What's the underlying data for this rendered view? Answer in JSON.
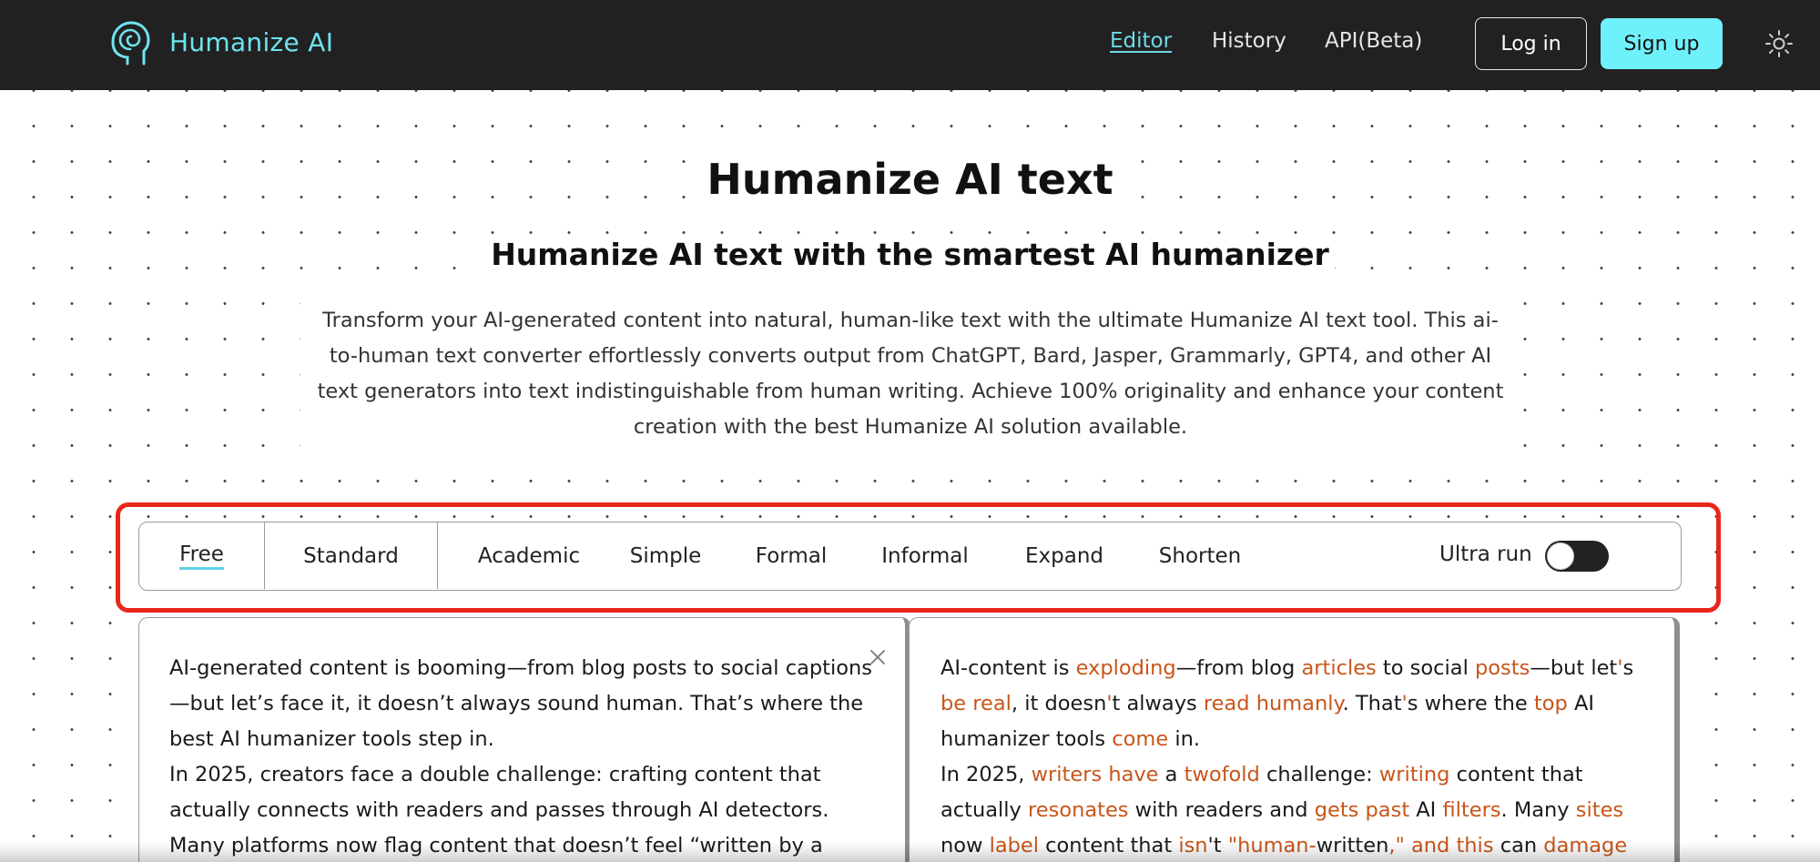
{
  "header": {
    "brand": "Humanize AI",
    "nav": [
      {
        "label": "Editor",
        "active": true
      },
      {
        "label": "History",
        "active": false
      },
      {
        "label": "API(Beta)",
        "active": false
      }
    ],
    "login_label": "Log in",
    "signup_label": "Sign up",
    "icons": {
      "logo": "head-spiral-icon",
      "theme": "sun-icon"
    }
  },
  "hero": {
    "title": "Humanize AI text",
    "subtitle": "Humanize AI text with the smartest AI humanizer",
    "description": "Transform your AI-generated content into natural, human-like text with the ultimate Humanize AI text tool. This ai-to-human text converter effortlessly converts output from ChatGPT, Bard, Jasper, Grammarly, GPT4, and other AI text generators into text indistinguishable from human writing. Achieve 100% originality and enhance your content creation with the best Humanize AI solution available."
  },
  "modes": {
    "items": [
      "Free",
      "Standard",
      "Academic",
      "Simple",
      "Formal",
      "Informal",
      "Expand",
      "Shorten"
    ],
    "selected": "Free",
    "ultra_run_label": "Ultra run",
    "ultra_run_enabled": false
  },
  "editor": {
    "input_paragraphs": [
      "AI-generated content is booming—from blog posts to social captions—but let’s face it, it doesn’t always sound human. That’s where the best AI humanizer tools step in.",
      "In 2025, creators face a double challenge: crafting content that actually connects with readers and passes through AI detectors. Many platforms now flag content that doesn’t feel “written by a human,” which can hurt"
    ],
    "output_paragraphs": [
      [
        {
          "t": "AI-content is "
        },
        {
          "t": "exploding",
          "c": 1
        },
        {
          "t": "—from blog "
        },
        {
          "t": "articles",
          "c": 1
        },
        {
          "t": " to social "
        },
        {
          "t": "posts",
          "c": 1
        },
        {
          "t": "—but let"
        },
        {
          "t": "'",
          "c": 1
        },
        {
          "t": "s "
        },
        {
          "t": "be real",
          "c": 1
        },
        {
          "t": ", it doesn"
        },
        {
          "t": "'",
          "c": 1
        },
        {
          "t": "t always "
        },
        {
          "t": "read humanly",
          "c": 1
        },
        {
          "t": ". That"
        },
        {
          "t": "'",
          "c": 1
        },
        {
          "t": "s where the "
        },
        {
          "t": "top",
          "c": 1
        },
        {
          "t": " AI humanizer tools "
        },
        {
          "t": "come",
          "c": 1
        },
        {
          "t": " in."
        }
      ],
      [
        {
          "t": "In 2025, "
        },
        {
          "t": "writers have",
          "c": 1
        },
        {
          "t": " a "
        },
        {
          "t": "twofold",
          "c": 1
        },
        {
          "t": " challenge: "
        },
        {
          "t": "writing",
          "c": 1
        },
        {
          "t": " content that actually "
        },
        {
          "t": "resonates",
          "c": 1
        },
        {
          "t": " with readers and "
        },
        {
          "t": "gets past",
          "c": 1
        },
        {
          "t": " AI "
        },
        {
          "t": "filters",
          "c": 1
        },
        {
          "t": ". Many "
        },
        {
          "t": "sites",
          "c": 1
        },
        {
          "t": " now "
        },
        {
          "t": "label",
          "c": 1
        },
        {
          "t": " content that "
        },
        {
          "t": "isn",
          "c": 1
        },
        {
          "t": "'t "
        },
        {
          "t": "\"human-",
          "c": 1
        },
        {
          "t": "written"
        },
        {
          "t": ",\" and this",
          "c": 1
        },
        {
          "t": " can "
        },
        {
          "t": "damage",
          "c": 1
        },
        {
          "t": " engagement,"
        }
      ]
    ],
    "changed_color": "#c8561a"
  },
  "colors": {
    "header_bg": "#212121",
    "brand": "#6fe3ef",
    "signup_bg": "#6ff1fb",
    "highlight": "#e8271b"
  }
}
